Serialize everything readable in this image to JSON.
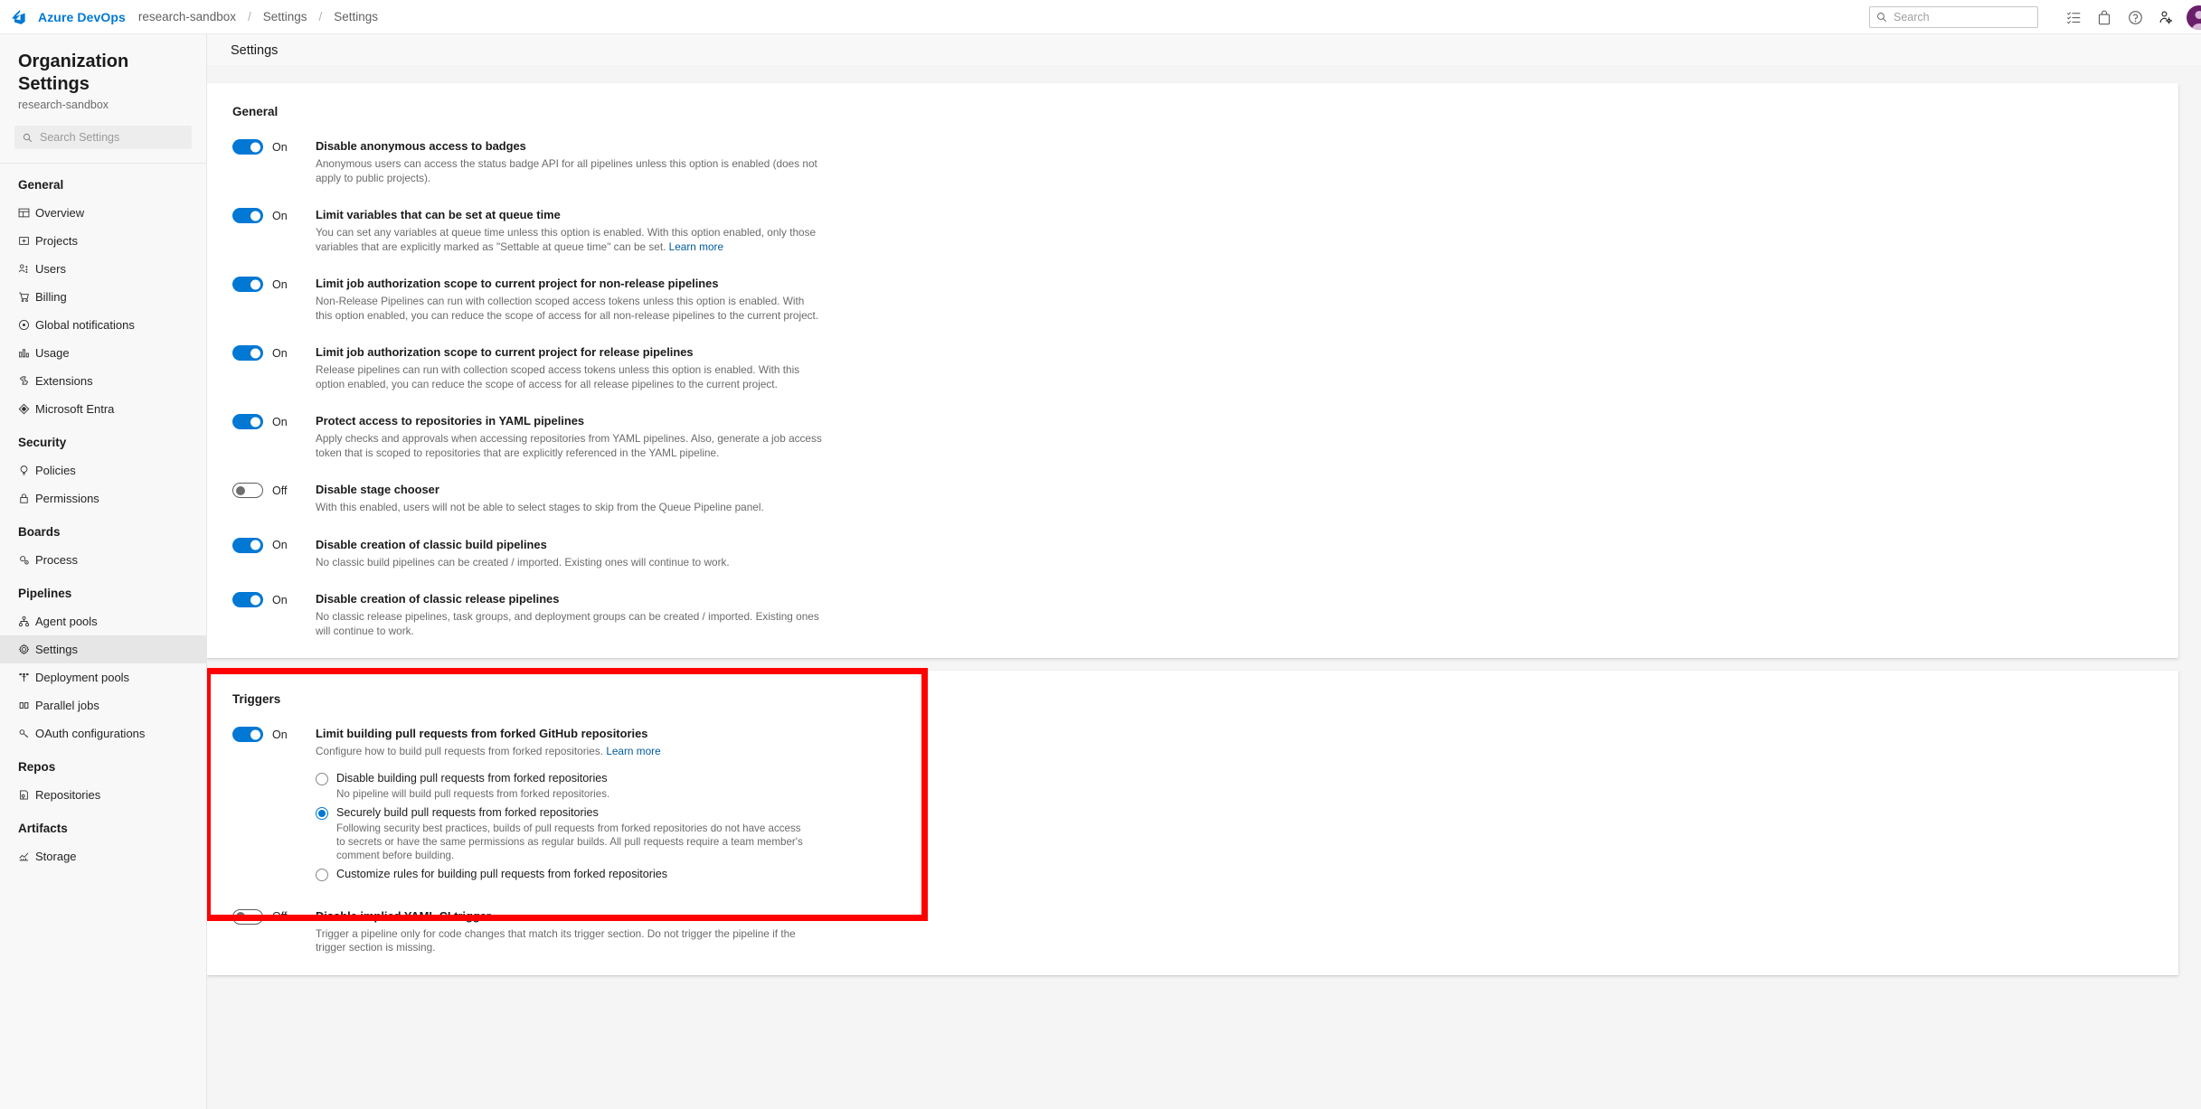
{
  "topbar": {
    "logo_icon": "azure-devops-logo",
    "brand": "Azure DevOps",
    "breadcrumb": [
      "research-sandbox",
      "Settings",
      "Settings"
    ],
    "separator": "/",
    "search_placeholder": "Search",
    "search_value": "",
    "icons": [
      "search-icon",
      "work-items-icon",
      "marketplace-icon",
      "help-icon",
      "user-settings-icon",
      "avatar"
    ]
  },
  "sidebar": {
    "title": "Organization Settings",
    "subtitle": "research-sandbox",
    "search_placeholder": "Search Settings",
    "search_value": "",
    "groups": [
      {
        "label": "General",
        "items": [
          {
            "label": "Overview",
            "icon": "overview-icon",
            "active": false
          },
          {
            "label": "Projects",
            "icon": "projects-icon",
            "active": false
          },
          {
            "label": "Users",
            "icon": "users-icon",
            "active": false
          },
          {
            "label": "Billing",
            "icon": "billing-cart-icon",
            "active": false
          },
          {
            "label": "Global notifications",
            "icon": "notifications-icon",
            "active": false
          },
          {
            "label": "Usage",
            "icon": "usage-chart-icon",
            "active": false
          },
          {
            "label": "Extensions",
            "icon": "extensions-puzzle-icon",
            "active": false
          },
          {
            "label": "Microsoft Entra",
            "icon": "entra-icon",
            "active": false
          }
        ]
      },
      {
        "label": "Security",
        "items": [
          {
            "label": "Policies",
            "icon": "policies-icon",
            "active": false
          },
          {
            "label": "Permissions",
            "icon": "permissions-lock-icon",
            "active": false
          }
        ]
      },
      {
        "label": "Boards",
        "items": [
          {
            "label": "Process",
            "icon": "process-icon",
            "active": false
          }
        ]
      },
      {
        "label": "Pipelines",
        "items": [
          {
            "label": "Agent pools",
            "icon": "agent-pools-icon",
            "active": false
          },
          {
            "label": "Settings",
            "icon": "gear-icon",
            "active": true
          },
          {
            "label": "Deployment pools",
            "icon": "deployment-pools-icon",
            "active": false
          },
          {
            "label": "Parallel jobs",
            "icon": "parallel-jobs-icon",
            "active": false
          },
          {
            "label": "OAuth configurations",
            "icon": "oauth-key-icon",
            "active": false
          }
        ]
      },
      {
        "label": "Repos",
        "items": [
          {
            "label": "Repositories",
            "icon": "repositories-icon",
            "active": false
          }
        ]
      },
      {
        "label": "Artifacts",
        "items": [
          {
            "label": "Storage",
            "icon": "storage-chart-icon",
            "active": false
          }
        ]
      }
    ]
  },
  "page": {
    "title": "Settings"
  },
  "general": {
    "title": "General",
    "settings": [
      {
        "state": "On",
        "on": true,
        "name": "Disable anonymous access to badges",
        "desc": "Anonymous users can access the status badge API for all pipelines unless this option is enabled (does not apply to public projects).",
        "link": ""
      },
      {
        "state": "On",
        "on": true,
        "name": "Limit variables that can be set at queue time",
        "desc": "You can set any variables at queue time unless this option is enabled. With this option enabled, only those variables that are explicitly marked as \"Settable at queue time\" can be set. ",
        "link": "Learn more"
      },
      {
        "state": "On",
        "on": true,
        "name": "Limit job authorization scope to current project for non-release pipelines",
        "desc": "Non-Release Pipelines can run with collection scoped access tokens unless this option is enabled. With this option enabled, you can reduce the scope of access for all non-release pipelines to the current project.",
        "link": ""
      },
      {
        "state": "On",
        "on": true,
        "name": "Limit job authorization scope to current project for release pipelines",
        "desc": "Release pipelines can run with collection scoped access tokens unless this option is enabled. With this option enabled, you can reduce the scope of access for all release pipelines to the current project.",
        "link": ""
      },
      {
        "state": "On",
        "on": true,
        "name": "Protect access to repositories in YAML pipelines",
        "desc": "Apply checks and approvals when accessing repositories from YAML pipelines. Also, generate a job access token that is scoped to repositories that are explicitly referenced in the YAML pipeline.",
        "link": ""
      },
      {
        "state": "Off",
        "on": false,
        "name": "Disable stage chooser",
        "desc": "With this enabled, users will not be able to select stages to skip from the Queue Pipeline panel.",
        "link": ""
      },
      {
        "state": "On",
        "on": true,
        "name": "Disable creation of classic build pipelines",
        "desc": "No classic build pipelines can be created / imported. Existing ones will continue to work.",
        "link": ""
      },
      {
        "state": "On",
        "on": true,
        "name": "Disable creation of classic release pipelines",
        "desc": "No classic release pipelines, task groups, and deployment groups can be created / imported. Existing ones will continue to work.",
        "link": ""
      }
    ]
  },
  "triggers": {
    "title": "Triggers",
    "highlighted": true,
    "highlight_color": "#ff0000",
    "fork_setting": {
      "state": "On",
      "on": true,
      "name": "Limit building pull requests from forked GitHub repositories",
      "desc": "Configure how to build pull requests from forked repositories. ",
      "link": "Learn more",
      "options": [
        {
          "label": "Disable building pull requests from forked repositories",
          "desc": "No pipeline will build pull requests from forked repositories.",
          "selected": false
        },
        {
          "label": "Securely build pull requests from forked repositories",
          "desc": "Following security best practices, builds of pull requests from forked repositories do not have access to secrets or have the same permissions as regular builds. All pull requests require a team member's comment before building.",
          "selected": true
        },
        {
          "label": "Customize rules for building pull requests from forked repositories",
          "desc": "",
          "selected": false
        }
      ]
    },
    "yaml_ci_setting": {
      "state": "Off",
      "on": false,
      "name": "Disable implied YAML CI trigger",
      "desc": "Trigger a pipeline only for code changes that match its trigger section. Do not trigger the pipeline if the trigger section is missing.",
      "link": ""
    }
  }
}
